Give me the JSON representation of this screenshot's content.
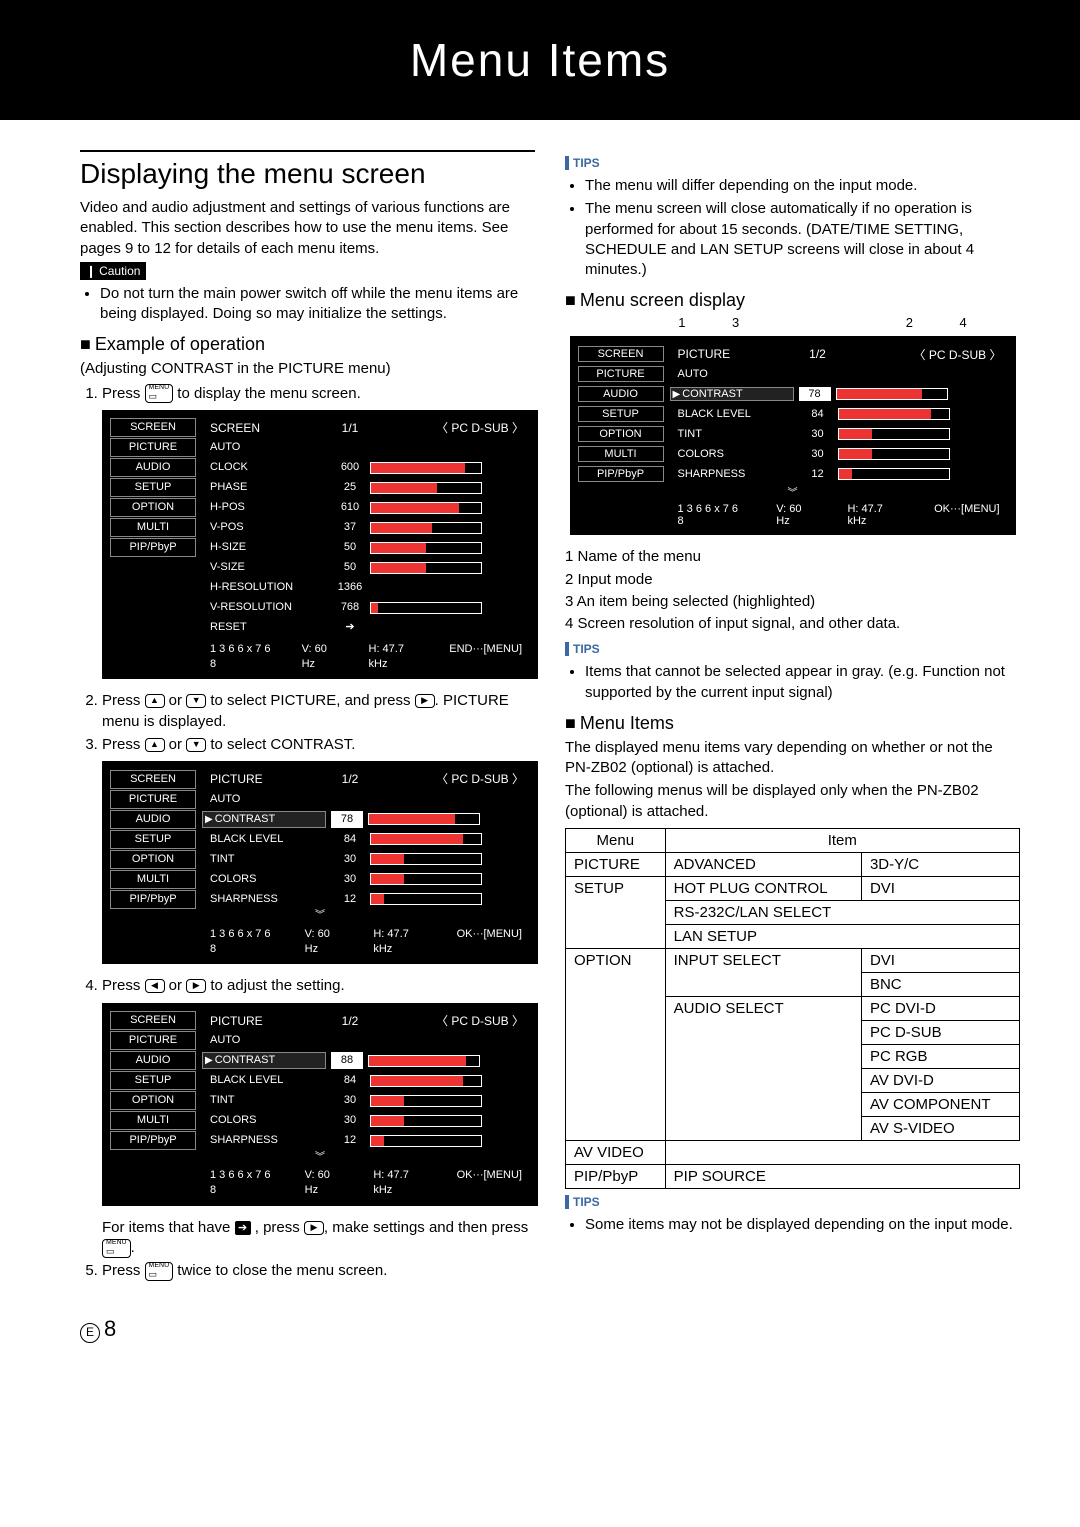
{
  "header_title": "Menu Items",
  "page_number": "8",
  "left": {
    "h2": "Displaying the menu screen",
    "intro": "Video and audio adjustment and settings of various functions are enabled. This section describes how to use the menu items. See pages 9 to 12 for details of each menu items.",
    "caution_label": "Caution",
    "caution_text": "Do not turn the main power switch off while the menu items are being displayed. Doing so may initialize the settings.",
    "h3_example": "Example of operation",
    "example_sub": "(Adjusting CONTRAST in the PICTURE menu)",
    "step1": "Press ",
    "step1b": " to display the menu screen.",
    "step2a": "Press ",
    "step2b": " or ",
    "step2c": " to select PICTURE, and press ",
    "step2d": ". PICTURE menu is displayed.",
    "step3a": "Press ",
    "step3b": " or ",
    "step3c": " to select CONTRAST.",
    "step4a": "Press ",
    "step4b": " or ",
    "step4c": " to adjust the setting.",
    "note_items": "For items that have ",
    "note_items2": " , press ",
    "note_items3": ", make settings and then press ",
    "note_items4": ".",
    "step5a": "Press ",
    "step5b": " twice to close the menu screen.",
    "menu_button_top": "MENU",
    "sidebar": [
      "SCREEN",
      "PICTURE",
      "AUDIO",
      "SETUP",
      "OPTION",
      "MULTI",
      "PIP/PbyP"
    ],
    "osd1": {
      "title": "SCREEN",
      "page": "1/1",
      "input": "〈 PC D-SUB 〉",
      "rows": [
        {
          "label": "AUTO",
          "val": "",
          "bar": null
        },
        {
          "label": "CLOCK",
          "val": "600",
          "bar": 85
        },
        {
          "label": "PHASE",
          "val": "25",
          "bar": 60
        },
        {
          "label": "H-POS",
          "val": "610",
          "bar": 80
        },
        {
          "label": "V-POS",
          "val": "37",
          "bar": 55
        },
        {
          "label": "H-SIZE",
          "val": "50",
          "bar": 50
        },
        {
          "label": "V-SIZE",
          "val": "50",
          "bar": 50
        },
        {
          "label": "H-RESOLUTION",
          "val": "1366",
          "bar": null
        },
        {
          "label": "V-RESOLUTION",
          "val": "768",
          "bar": 6
        },
        {
          "label": "RESET",
          "val": "➔",
          "bar": null
        }
      ],
      "status_res": "1 3 6 6 x 7 6 8",
      "status_v": "V: 60 Hz",
      "status_h": "H: 47.7 kHz",
      "status_end": "END···[MENU]"
    },
    "osd2": {
      "title": "PICTURE",
      "page": "1/2",
      "input": "〈 PC D-SUB 〉",
      "rows": [
        {
          "label": "AUTO",
          "val": "",
          "bar": null,
          "sel": false
        },
        {
          "label": "CONTRAST",
          "val": "78",
          "bar": 78,
          "sel": true,
          "boxed": true
        },
        {
          "label": "BLACK LEVEL",
          "val": "84",
          "bar": 84
        },
        {
          "label": "TINT",
          "val": "30",
          "bar": 30
        },
        {
          "label": "COLORS",
          "val": "30",
          "bar": 30
        },
        {
          "label": "SHARPNESS",
          "val": "12",
          "bar": 12
        }
      ],
      "status_res": "1 3 6 6 x 7 6 8",
      "status_v": "V: 60 Hz",
      "status_h": "H: 47.7 kHz",
      "status_end": "OK···[MENU]"
    },
    "osd3": {
      "title": "PICTURE",
      "page": "1/2",
      "input": "〈 PC D-SUB 〉",
      "rows": [
        {
          "label": "AUTO",
          "val": "",
          "bar": null,
          "sel": false
        },
        {
          "label": "CONTRAST",
          "val": "88",
          "bar": 88,
          "sel": true,
          "boxed": true
        },
        {
          "label": "BLACK LEVEL",
          "val": "84",
          "bar": 84
        },
        {
          "label": "TINT",
          "val": "30",
          "bar": 30
        },
        {
          "label": "COLORS",
          "val": "30",
          "bar": 30
        },
        {
          "label": "SHARPNESS",
          "val": "12",
          "bar": 12
        }
      ],
      "status_res": "1 3 6 6 x 7 6 8",
      "status_v": "V: 60 Hz",
      "status_h": "H: 47.7 kHz",
      "status_end": "OK···[MENU]"
    }
  },
  "right": {
    "tips_label": "TIPS",
    "tips1": [
      "The menu will differ depending on the input mode.",
      "The menu screen will close automatically if no operation is performed for about 15 seconds. (DATE/TIME SETTING, SCHEDULE and LAN SETUP screens will close in about 4 minutes.)"
    ],
    "h3_display": "Menu screen display",
    "legend_nums": {
      "a": "1",
      "b": "3",
      "c": "2",
      "d": "4"
    },
    "osd": {
      "title": "PICTURE",
      "page": "1/2",
      "input": "〈 PC D-SUB 〉",
      "rows": [
        {
          "label": "AUTO",
          "val": "",
          "bar": null
        },
        {
          "label": "CONTRAST",
          "val": "78",
          "bar": 78,
          "sel": true,
          "boxed": true
        },
        {
          "label": "BLACK LEVEL",
          "val": "84",
          "bar": 84
        },
        {
          "label": "TINT",
          "val": "30",
          "bar": 30
        },
        {
          "label": "COLORS",
          "val": "30",
          "bar": 30
        },
        {
          "label": "SHARPNESS",
          "val": "12",
          "bar": 12
        }
      ],
      "status_res": "1 3 6 6 x 7 6 8",
      "status_v": "V: 60 Hz",
      "status_h": "H: 47.7 kHz",
      "status_end": "OK···[MENU]"
    },
    "legend": [
      "1  Name of the menu",
      "2  Input mode",
      "3  An item being selected (highlighted)",
      "4  Screen resolution of input signal, and other data."
    ],
    "tips2": [
      "Items that cannot be selected appear in gray. (e.g. Function not supported by the current input signal)"
    ],
    "h3_items": "Menu Items",
    "items_p1": "The displayed menu items vary depending on whether or not the PN-ZB02 (optional) is attached.",
    "items_p2": "The following menus will be displayed only when the PN-ZB02 (optional) is attached.",
    "table": {
      "head": [
        "Menu",
        "Item"
      ],
      "rows": [
        {
          "menu": "PICTURE",
          "c1": "ADVANCED",
          "c2": "3D-Y/C"
        },
        {
          "menu": "SETUP",
          "rowspan": 3,
          "c1": "HOT PLUG CONTROL",
          "c2": "DVI"
        },
        {
          "c1": "RS-232C/LAN SELECT",
          "colspan": 2
        },
        {
          "c1": "LAN SETUP",
          "colspan": 2
        },
        {
          "menu": "OPTION",
          "rowspan": 8,
          "c1": "INPUT SELECT",
          "c1rowspan": 2,
          "c2": "DVI"
        },
        {
          "c2": "BNC"
        },
        {
          "c1": "AUDIO SELECT",
          "c1rowspan": 6,
          "c2": "PC DVI-D"
        },
        {
          "c2": "PC D-SUB"
        },
        {
          "c2": "PC RGB"
        },
        {
          "c2": "AV DVI-D"
        },
        {
          "c2": "AV COMPONENT"
        },
        {
          "c2": "AV S-VIDEO"
        },
        {
          "c2": "AV VIDEO"
        },
        {
          "menu": "PIP/PbyP",
          "c1": "PIP SOURCE",
          "colspan": 2
        }
      ]
    },
    "tips3": [
      "Some items may not be displayed depending on the input mode."
    ]
  }
}
